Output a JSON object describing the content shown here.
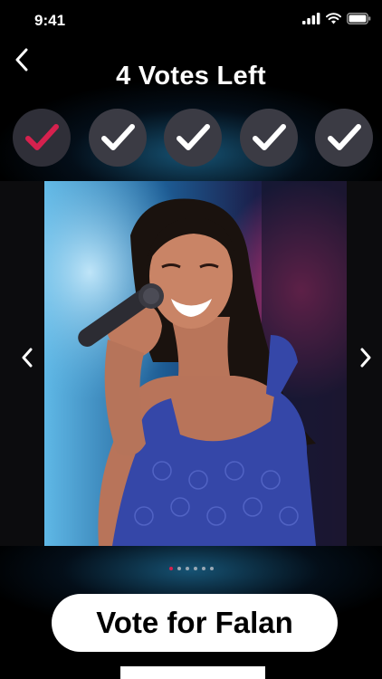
{
  "status_bar": {
    "time": "9:41"
  },
  "header": {
    "title": "4 Votes Left"
  },
  "votes": [
    {
      "state": "used",
      "icon": "check-icon",
      "color": "#d6214e"
    },
    {
      "state": "available",
      "icon": "check-icon",
      "color": "#ffffff"
    },
    {
      "state": "available",
      "icon": "check-icon",
      "color": "#ffffff"
    },
    {
      "state": "available",
      "icon": "check-icon",
      "color": "#ffffff"
    },
    {
      "state": "available",
      "icon": "check-icon",
      "color": "#ffffff"
    }
  ],
  "carousel": {
    "total_pages": 6,
    "active_index": 0
  },
  "vote_button": {
    "label": "Vote for Falan"
  },
  "colors": {
    "accent": "#d6214e",
    "circle_bg": "#3b3b44",
    "background": "#000000"
  }
}
